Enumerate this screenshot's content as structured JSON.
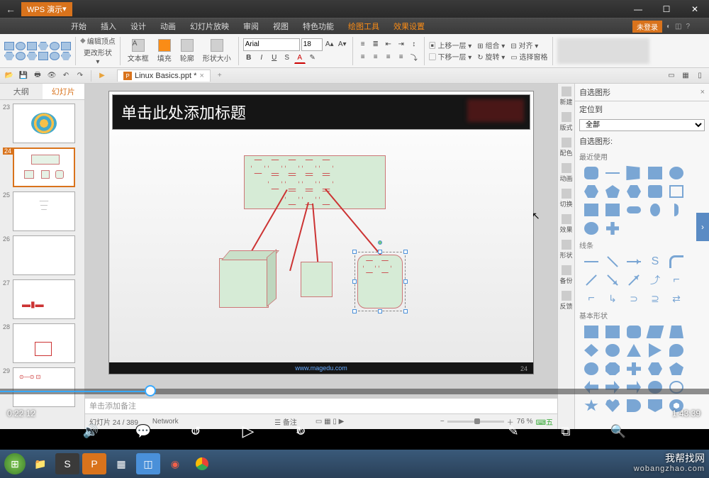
{
  "titlebar": {
    "app": "WPS 演示",
    "back": "←"
  },
  "window": {
    "min": "—",
    "max": "☐",
    "close": "✕"
  },
  "ribbon_tabs": [
    "开始",
    "插入",
    "设计",
    "动画",
    "幻灯片放映",
    "审阅",
    "视图",
    "特色功能",
    "绘图工具",
    "效果设置"
  ],
  "ribbon_active_idx": 8,
  "login": "未登录",
  "ribbon": {
    "editVertex": "编辑顶点",
    "changeShape": "更改形状",
    "textbox": "文本框",
    "fill": "填充",
    "outline": "轮廓",
    "shapeSize": "形状大小",
    "font": "Arial",
    "size": "18",
    "bold": "B",
    "italic": "I",
    "underline": "U",
    "strike": "S",
    "fontA": "A",
    "bringFwd": "上移一层",
    "sendBack": "下移一层",
    "group": "组合",
    "rotate": "旋转",
    "align": "对齐",
    "selPane": "选择窗格"
  },
  "doc": {
    "name": "Linux Basics.ppt *",
    "addTab": "+"
  },
  "left_tabs": {
    "outline": "大纲",
    "slides": "幻灯片"
  },
  "thumbs": [
    {
      "n": "23"
    },
    {
      "n": "24",
      "sel": true
    },
    {
      "n": "25"
    },
    {
      "n": "26"
    },
    {
      "n": "27"
    },
    {
      "n": "28"
    },
    {
      "n": "29"
    }
  ],
  "slide": {
    "title": "单击此处添加标题",
    "url": "www.magedu.com",
    "num": "24"
  },
  "notes": "单击添加备注",
  "status": {
    "slide": "幻灯片 24 / 389",
    "center": "Network",
    "spellcheck": "备注",
    "zoom": "76 %"
  },
  "side_tasks": [
    {
      "k": "new",
      "l": "新建"
    },
    {
      "k": "fmt",
      "l": "版式"
    },
    {
      "k": "color",
      "l": "配色"
    },
    {
      "k": "anim",
      "l": "动画"
    },
    {
      "k": "trans",
      "l": "切换"
    },
    {
      "k": "fx",
      "l": "效果"
    },
    {
      "k": "shape",
      "l": "形状"
    },
    {
      "k": "bak",
      "l": "备份"
    },
    {
      "k": "fb",
      "l": "反馈"
    }
  ],
  "right": {
    "title": "自选图形",
    "locate": "定位到",
    "locateVal": "全部",
    "autoshape": "自选图形:",
    "recent": "最近使用",
    "lines": "线条",
    "basic": "基本形状"
  },
  "video": {
    "cur": "0:22:12",
    "dur": "1:43:39",
    "back": "10",
    "fwd": "30"
  },
  "watermark": {
    "cn": "我帮找网",
    "en": "wobangzhao.com"
  }
}
